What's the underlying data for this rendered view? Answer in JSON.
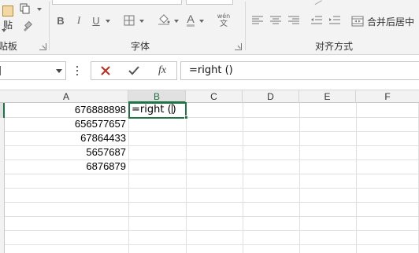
{
  "ribbon": {
    "groups": {
      "clipboard": {
        "paste_label": "贴",
        "label": "剪贴板"
      },
      "font": {
        "label": "字体",
        "bold": "B",
        "italic": "I",
        "underline": "U",
        "font_color_letter": "A",
        "phonetic_top": "wén"
      },
      "alignment": {
        "label": "对齐方式",
        "merge_label": "合并后居中"
      }
    }
  },
  "formula_bar": {
    "cancel_icon": "x-icon",
    "enter_icon": "check-icon",
    "fx_label": "fx",
    "formula": "=right ()"
  },
  "grid": {
    "columns": [
      "A",
      "B",
      "C",
      "D",
      "E",
      "F"
    ],
    "active_column": "B",
    "column_a_values": [
      "676888898",
      "656577657",
      "67864433",
      "5657687",
      "6876879"
    ],
    "active_cell_text": "=right (",
    "active_cell_after_caret": ")"
  },
  "colors": {
    "accent": "#217346",
    "cancel": "#c42b1c",
    "ribbon_bg": "#f3f3f3"
  }
}
